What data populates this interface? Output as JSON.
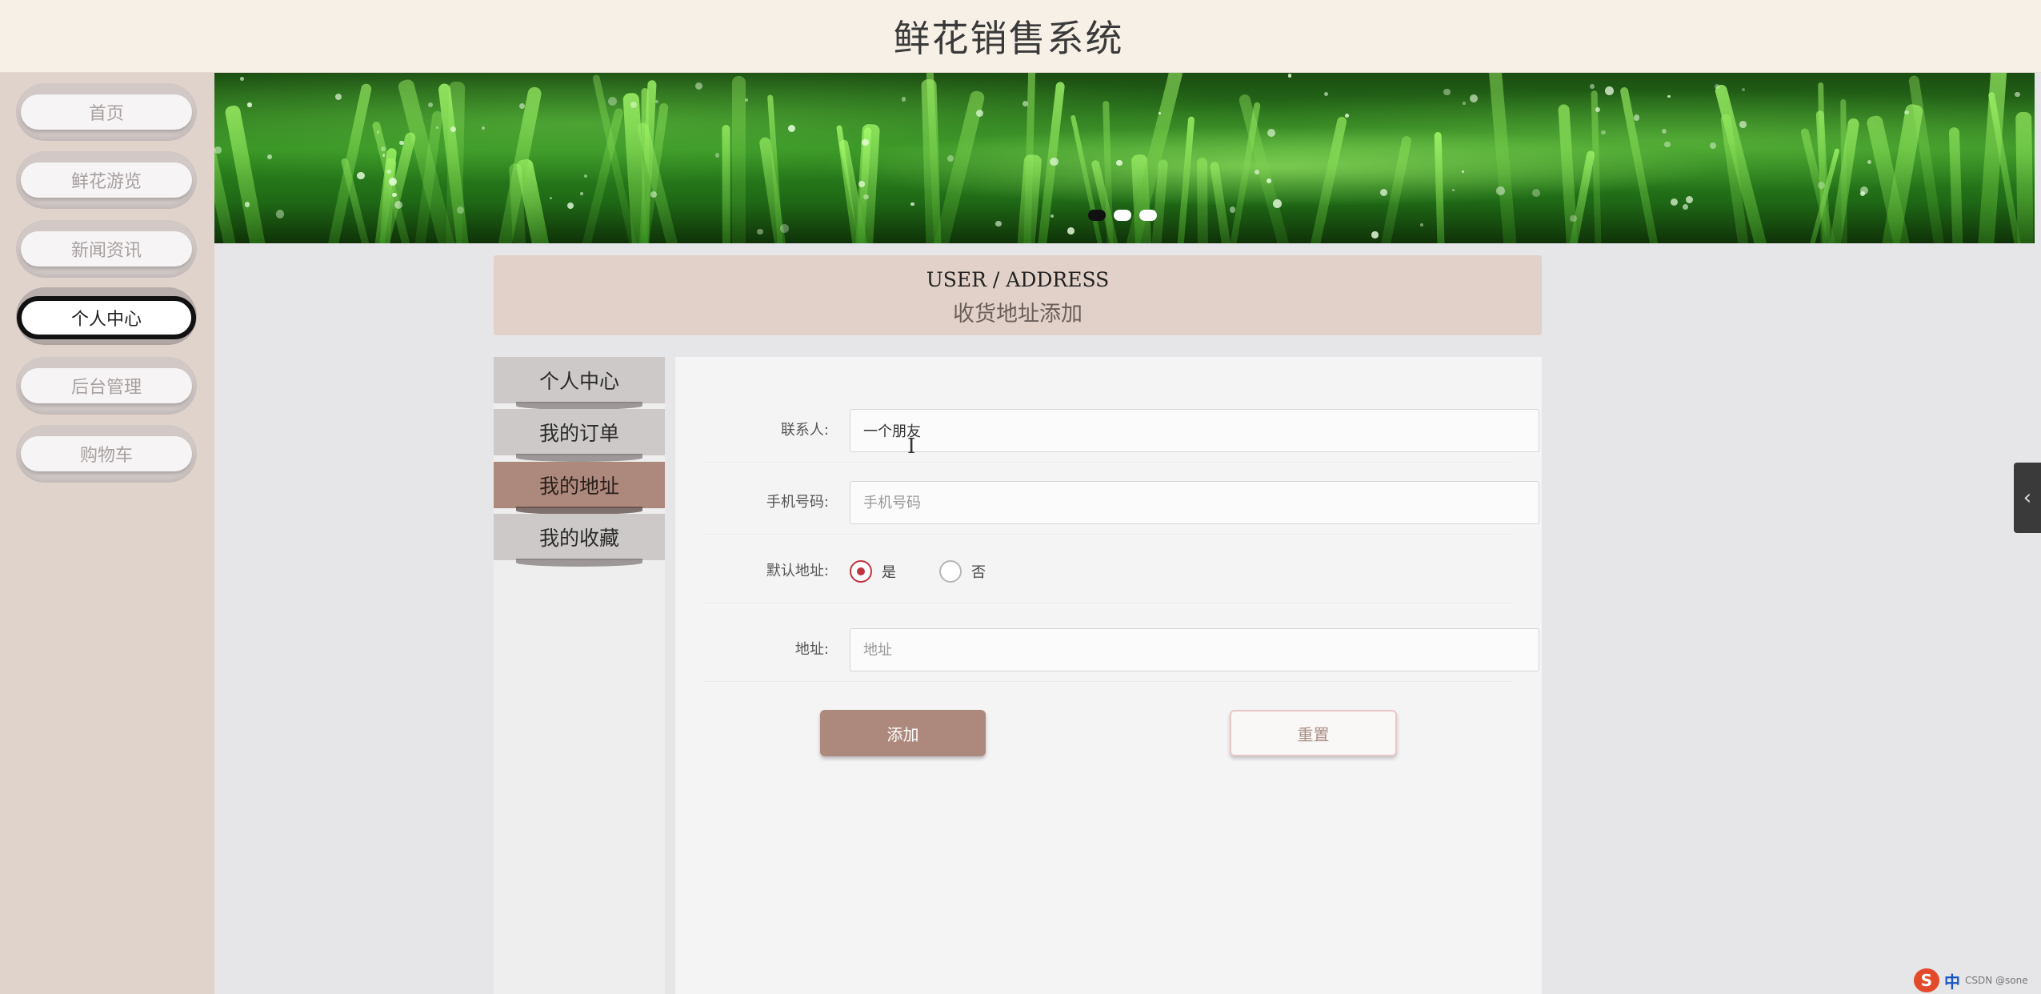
{
  "app": {
    "title": "鲜花销售系统"
  },
  "sidebar": {
    "items": [
      {
        "label": "首页",
        "active": false
      },
      {
        "label": "鲜花游览",
        "active": false
      },
      {
        "label": "新闻资讯",
        "active": false
      },
      {
        "label": "个人中心",
        "active": true
      },
      {
        "label": "后台管理",
        "active": false
      },
      {
        "label": "购物车",
        "active": false
      }
    ]
  },
  "banner": {
    "slides": 3,
    "active_slide": 1
  },
  "section": {
    "title_en": "USER / ADDRESS",
    "title_cn": "收货地址添加"
  },
  "side_menu": {
    "items": [
      {
        "label": "个人中心",
        "active": false
      },
      {
        "label": "我的订单",
        "active": false
      },
      {
        "label": "我的地址",
        "active": true
      },
      {
        "label": "我的收藏",
        "active": false
      }
    ]
  },
  "form": {
    "contact": {
      "label": "联系人:",
      "value": "一个朋友",
      "placeholder": ""
    },
    "phone": {
      "label": "手机号码:",
      "value": "",
      "placeholder": "手机号码"
    },
    "default_address": {
      "label": "默认地址:",
      "options": [
        {
          "label": "是",
          "checked": true
        },
        {
          "label": "否",
          "checked": false
        }
      ]
    },
    "address": {
      "label": "地址:",
      "value": "",
      "placeholder": "地址"
    },
    "add_button": "添加",
    "reset_button": "重置"
  },
  "tray": {
    "ime_logo": "S",
    "ime_mode": "中",
    "extra": "CSDN @sone"
  },
  "colors": {
    "accent": "#ad897d",
    "header_bg": "#f7f0e6",
    "sidebar_bg": "#e0d3cc",
    "radio_checked": "#c0343f"
  }
}
